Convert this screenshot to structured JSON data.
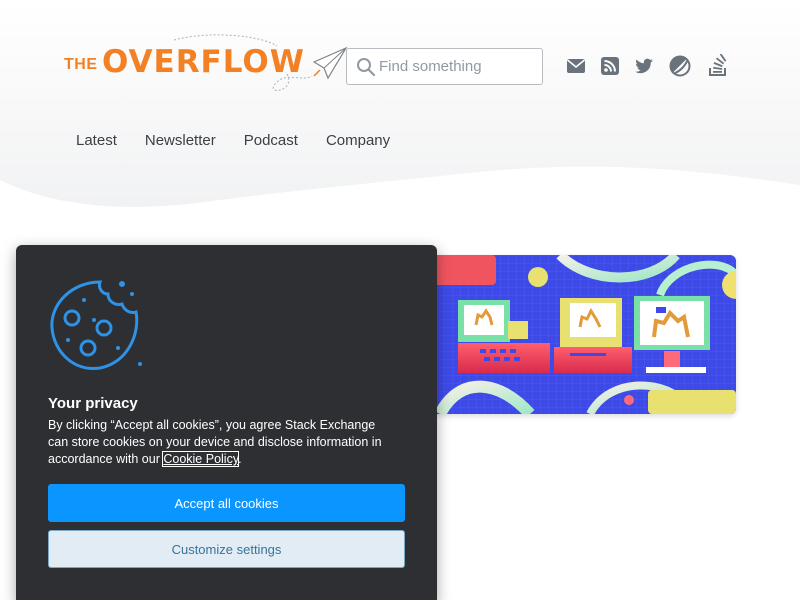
{
  "header": {
    "logo_prefix": "THE",
    "logo_name": "OVERFLOW",
    "search": {
      "placeholder": "Find something",
      "value": ""
    },
    "social_icons": [
      "mail-icon",
      "rss-icon",
      "twitter-icon",
      "podcast-icon",
      "stackoverflow-icon"
    ]
  },
  "nav": {
    "items": [
      {
        "label": "Latest"
      },
      {
        "label": "Newsletter"
      },
      {
        "label": "Podcast"
      },
      {
        "label": "Company"
      }
    ]
  },
  "cookie_banner": {
    "title": "Your privacy",
    "text_before": "By clicking “Accept all cookies”, you agree Stack Exchange can store cookies on your device and disclose information in accordance with our ",
    "link": "Cookie Policy",
    "text_after": ".",
    "accept_label": "Accept all cookies",
    "customize_label": "Customize settings"
  },
  "colors": {
    "brand_orange": "#f48024",
    "accept_blue": "#0a95ff",
    "banner_bg": "#2d2f33",
    "hero_bg": "#3d4ae8"
  }
}
